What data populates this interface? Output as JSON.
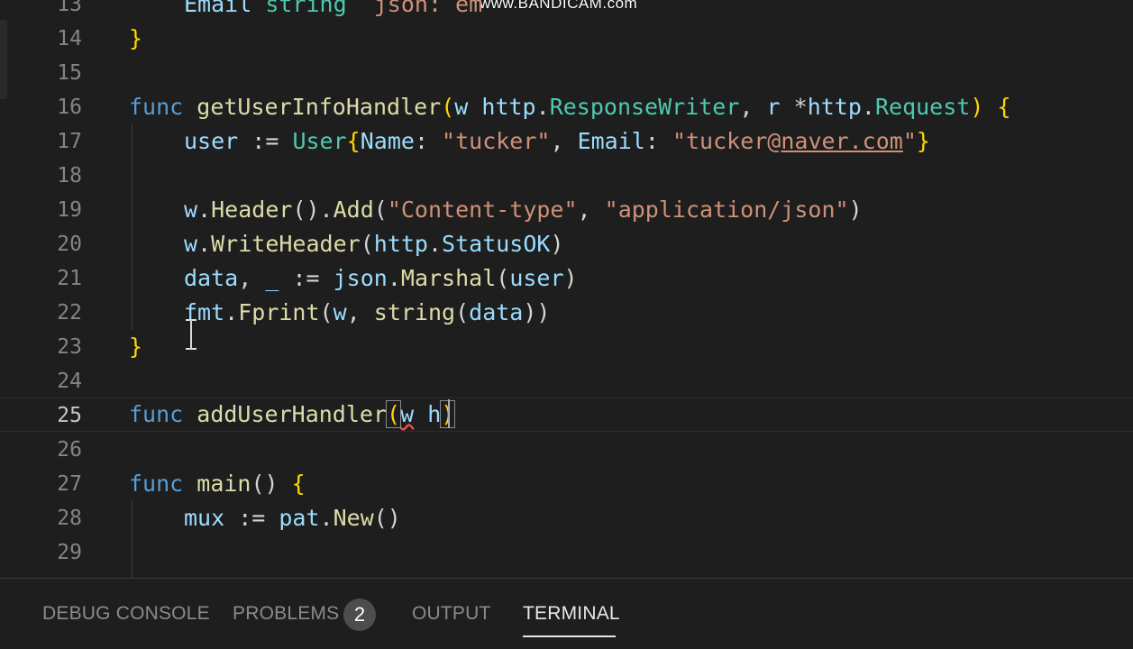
{
  "watermark": "www.BANDICAM.com",
  "editor": {
    "lines": [
      {
        "num": "13",
        "text": "    Email string `json: em"
      },
      {
        "num": "14",
        "text": "}"
      },
      {
        "num": "15",
        "text": ""
      },
      {
        "num": "16",
        "text": "func getUserInfoHandler(w http.ResponseWriter, r *http.Request) {"
      },
      {
        "num": "17",
        "text": "    user := User{Name: \"tucker\", Email: \"tucker@naver.com\"}"
      },
      {
        "num": "18",
        "text": ""
      },
      {
        "num": "19",
        "text": "    w.Header().Add(\"Content-type\", \"application/json\")"
      },
      {
        "num": "20",
        "text": "    w.WriteHeader(http.StatusOK)"
      },
      {
        "num": "21",
        "text": "    data, _ := json.Marshal(user)"
      },
      {
        "num": "22",
        "text": "    fmt.Fprint(w, string(data))"
      },
      {
        "num": "23",
        "text": "}"
      },
      {
        "num": "24",
        "text": ""
      },
      {
        "num": "25",
        "text": "func addUserHandler(w h)"
      },
      {
        "num": "26",
        "text": ""
      },
      {
        "num": "27",
        "text": "func main() {"
      },
      {
        "num": "28",
        "text": "    mux := pat.New()"
      },
      {
        "num": "29",
        "text": ""
      }
    ]
  },
  "panel": {
    "tabs": [
      {
        "label": "DEBUG CONSOLE"
      },
      {
        "label": "PROBLEMS"
      },
      {
        "label": "OUTPUT"
      },
      {
        "label": "TERMINAL"
      }
    ],
    "problems_count": "2",
    "active_tab": "TERMINAL"
  },
  "colors": {
    "background": "#1e1e1e",
    "keyword": "#569cd6",
    "function": "#dcdcaa",
    "string": "#ce9178",
    "variable": "#9cdcfe",
    "type": "#4ec9b0"
  }
}
